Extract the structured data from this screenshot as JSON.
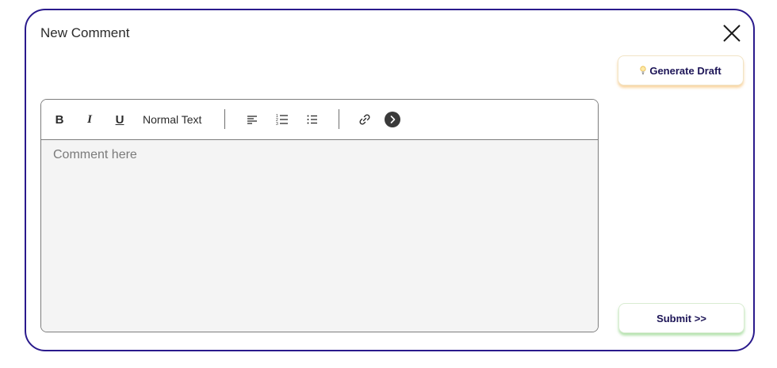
{
  "modal": {
    "title": "New Comment"
  },
  "actions": {
    "generate_draft_label": "Generate Draft",
    "submit_label": "Submit >>"
  },
  "toolbar": {
    "bold_label": "B",
    "italic_label": "I",
    "underline_label": "U",
    "text_format": "Normal Text"
  },
  "editor": {
    "placeholder": "Comment here",
    "value": ""
  },
  "colors": {
    "modal_border": "#2a1a8c",
    "primary_text": "#1c1456",
    "generate_glow": "#f4b258",
    "submit_glow": "#84ce78",
    "editor_background": "#f4f4f4"
  }
}
